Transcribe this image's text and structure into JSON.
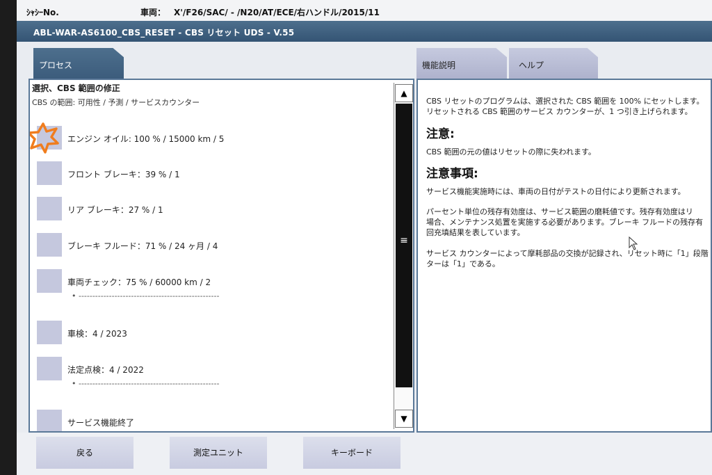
{
  "header": {
    "chassis_label": "ｼｬｼｰNo.",
    "vehicle_label": "車両：",
    "vehicle_value": "X'/F26/SAC/ - /N20/AT/ECE/右ハンドル/2015/11"
  },
  "window": {
    "title": "ABL-WAR-AS6100_CBS_RESET - CBS リセット UDS - V.55"
  },
  "tabs": {
    "process": "プロセス",
    "function_desc": "機能説明",
    "help": "ヘルプ"
  },
  "process": {
    "title": "選択、CBS 範囲の修正",
    "subtitle": "CBS の範囲: 可用性 / 予測 / サービスカウンター",
    "steps": [
      {
        "label": "エンジン オイル: 100 % / 15000 km / 5"
      },
      {
        "label": "フロント ブレーキ：39 % / 1"
      },
      {
        "label": "リア ブレーキ：27 % / 1"
      },
      {
        "label": "ブレーキ フルード：71 % / 24 ヶ月 / 4"
      },
      {
        "label": "車両チェック：75 % / 60000 km / 2"
      },
      {
        "label": "車検：4 / 2023"
      },
      {
        "label": "法定点検：4 / 2022"
      },
      {
        "label": "サービス機能終了"
      }
    ],
    "dash_line": "•  ---------------------------------------------------"
  },
  "help": {
    "p1_line1": "CBS リセットのプログラムは、選択された CBS 範囲を 100% にセットします。",
    "p1_line2": "リセットされる CBS 範囲のサービス カウンターが、1 つ引き上げられます。",
    "heading1": "注意:",
    "p2": "CBS 範囲の元の値はリセットの際に失われます。",
    "heading2": "注意事項:",
    "p3": "サービス機能実施時には、車両の日付がテストの日付により更新されます。",
    "p4_line1": "パーセント単位の残存有効度は、サービス範囲の磨耗値です。残存有効度はリ",
    "p4_line2": "場合、メンテナンス処置を実施する必要があります。ブレーキ フルードの残存有",
    "p4_line3": "回充填結果を表しています。",
    "p5_line1": "サービス カウンターによって摩耗部品の交換が記録され、リセット時に「1」段階",
    "p5_line2": "ターは「1」である。"
  },
  "buttons": {
    "back": "戻る",
    "measure": "測定ユニット",
    "keyboard": "キーボード"
  },
  "colors": {
    "title_bar": "#3f6080",
    "selected_star": "#f07d1e",
    "step_box": "#c5c8de",
    "scroll_thumb": "#111111"
  }
}
